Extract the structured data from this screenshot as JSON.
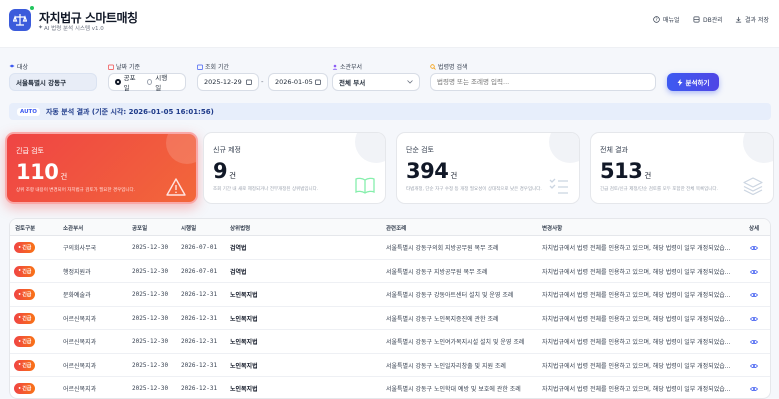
{
  "app": {
    "title": "자치법규 스마트매칭",
    "subtitle": "AI 법령 분석 시스템 v1.0"
  },
  "nav": [
    {
      "label": "매뉴얼",
      "icon": "help-icon"
    },
    {
      "label": "DB관리",
      "icon": "database-icon"
    },
    {
      "label": "결과 저장",
      "icon": "download-icon"
    }
  ],
  "filters": {
    "target_label": "대상",
    "target_value": "서울특별시 강동구",
    "date_basis_label": "날짜 기준",
    "date_options": [
      "공포일",
      "시행일"
    ],
    "date_selected": "공포일",
    "period_label": "조회 기간",
    "start_date": "2025-12-29",
    "end_date": "2026-01-05",
    "date_sep": "-",
    "dept_label": "소관부서",
    "dept_value": "전체 부서",
    "search_label": "법령명 검색",
    "search_placeholder": "법령명 또는 조례명 입력...",
    "analyze_label": "분석하기"
  },
  "status": {
    "chip": "AUTO",
    "text": "자동 분석 결과 (기준 시각: 2026-01-05 16:01:56)"
  },
  "cards": [
    {
      "label": "긴급 검토",
      "count": "110",
      "unit": "건",
      "desc": "상위 조항 내용이 변경되어 자치법규 검토가 필요한 경우입니다.",
      "icon": "warning-icon"
    },
    {
      "label": "신규 제정",
      "count": "9",
      "unit": "건",
      "desc": "조회 기간 내 새로 제정되거나 전부개정된 상위법입니다.",
      "icon": "book-icon"
    },
    {
      "label": "단순 검토",
      "count": "394",
      "unit": "건",
      "desc": "타법개정, 단순 자구 수정 등 개정 필요성이 상대적으로 낮은 경우입니다.",
      "icon": "checklist-icon"
    },
    {
      "label": "전체 결과",
      "count": "513",
      "unit": "건",
      "desc": "긴급 검토/신규 제정/단순 검토를 모두 포함한 전체 목록입니다.",
      "icon": "layers-icon"
    }
  ],
  "table": {
    "headers": [
      "검토구분",
      "소관부서",
      "공포일",
      "시행일",
      "상위법령",
      "관련조례",
      "변경사항",
      "상세"
    ],
    "rows": [
      {
        "badge": "긴급",
        "dept": "구의회사무국",
        "pub": "2025-12-30",
        "eff": "2026-07-01",
        "law": "검역법",
        "ordinance": "서울특별시 강동구의회 지방공무원 복무 조례",
        "change": "자치법규에서 법령 전체를 인용하고 있으며, 해당 법령이 일부 개정되었습..."
      },
      {
        "badge": "긴급",
        "dept": "행정지원과",
        "pub": "2025-12-30",
        "eff": "2026-07-01",
        "law": "검역법",
        "ordinance": "서울특별시 강동구 지방공무원 복무 조례",
        "change": "자치법규에서 법령 전체를 인용하고 있으며, 해당 법령이 일부 개정되었습..."
      },
      {
        "badge": "긴급",
        "dept": "문화예술과",
        "pub": "2025-12-30",
        "eff": "2026-12-31",
        "law": "노인복지법",
        "ordinance": "서울특별시 강동구 강동아트센터 설치 및 운영 조례",
        "change": "자치법규에서 법령 전체를 인용하고 있으며, 해당 법령이 일부 개정되었습..."
      },
      {
        "badge": "긴급",
        "dept": "어르신복지과",
        "pub": "2025-12-30",
        "eff": "2026-12-31",
        "law": "노인복지법",
        "ordinance": "서울특별시 강동구 노인복지증진에 관한 조례",
        "change": "자치법규에서 법령 전체를 인용하고 있으며, 해당 법령이 일부 개정되었습..."
      },
      {
        "badge": "긴급",
        "dept": "어르신복지과",
        "pub": "2025-12-30",
        "eff": "2026-12-31",
        "law": "노인복지법",
        "ordinance": "서울특별시 강동구 노인여가복지시설 설치 및 운영 조례",
        "change": "자치법규에서 법령 전체를 인용하고 있으며, 해당 법령이 일부 개정되었습..."
      },
      {
        "badge": "긴급",
        "dept": "어르신복지과",
        "pub": "2025-12-30",
        "eff": "2026-12-31",
        "law": "노인복지법",
        "ordinance": "서울특별시 강동구 노인일자리창출 및 지원 조례",
        "change": "자치법규에서 법령 전체를 인용하고 있으며, 해당 법령이 일부 개정되었습..."
      },
      {
        "badge": "긴급",
        "dept": "어르신복지과",
        "pub": "2025-12-30",
        "eff": "2026-12-31",
        "law": "노인복지법",
        "ordinance": "서울특별시 강동구 노인학대 예방 및 보호에 관한 조례",
        "change": "자치법규에서 법령 전체를 인용하고 있으며, 해당 법령이 일부 개정되었습..."
      }
    ]
  },
  "colors": {
    "accent": "#3d5af1",
    "urgent": "#ef4444",
    "status_bg": "#e7eefb"
  }
}
